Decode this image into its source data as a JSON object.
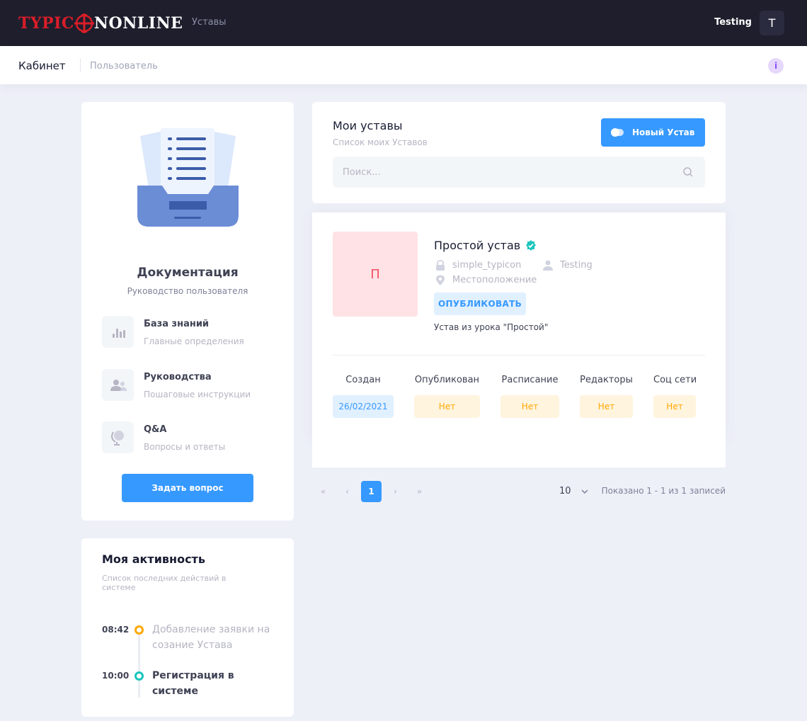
{
  "header": {
    "logo_part1": "TYPIC",
    "logo_part2": "NONLINE",
    "nav_link": "Уставы",
    "user_name": "Testing",
    "user_initial": "T"
  },
  "subheader": {
    "title": "Кабинет",
    "breadcrumb": "Пользователь",
    "info_icon": "i"
  },
  "documentation": {
    "title": "Документация",
    "subtitle": "Руководство пользователя",
    "items": [
      {
        "title": "База знаний",
        "subtitle": "Главные определения",
        "icon": "chart-bars-icon"
      },
      {
        "title": "Руководства",
        "subtitle": "Пошаговые инструкции",
        "icon": "users-icon"
      },
      {
        "title": "Q&A",
        "subtitle": "Вопросы и ответы",
        "icon": "globe-icon"
      }
    ],
    "ask_button": "Задать вопрос"
  },
  "activity": {
    "title": "Моя активность",
    "subtitle": "Список последних действий в системе",
    "entries": [
      {
        "time": "08:42",
        "text": "Добавление заявки на созание Устава",
        "color": "#ffa800"
      },
      {
        "time": "10:00",
        "text": "Регистрация в системе",
        "color": "#1bc5bd"
      }
    ]
  },
  "ustavy": {
    "title": "Мои уставы",
    "subtitle": "Список моих Уставов",
    "new_button": "Новый Устав",
    "search_placeholder": "Поиск..."
  },
  "typicon": {
    "thumb_letter": "П",
    "name": "Простой устав",
    "system_name": "simple_typicon",
    "owner": "Testing",
    "location": "Местоположение",
    "publish_button": "ОПУБЛИКОВАТЬ",
    "description": "Устав из урока \"Простой\"",
    "stats": [
      {
        "label": "Создан",
        "value": "26/02/2021"
      },
      {
        "label": "Опубликован",
        "value": "Нет"
      },
      {
        "label": "Расписание",
        "value": "Нет"
      },
      {
        "label": "Редакторы",
        "value": "Нет"
      },
      {
        "label": "Соц сети",
        "value": "Нет"
      }
    ]
  },
  "pagination": {
    "current_page": "1",
    "per_page": "10",
    "summary": "Показано 1 - 1 из 1 записей"
  },
  "colors": {
    "primary": "#3699ff",
    "header_bg": "#1e1e2d",
    "logo_red": "#d81e28",
    "warning": "#ffa800",
    "success": "#1bc5bd",
    "danger": "#f64e60"
  }
}
